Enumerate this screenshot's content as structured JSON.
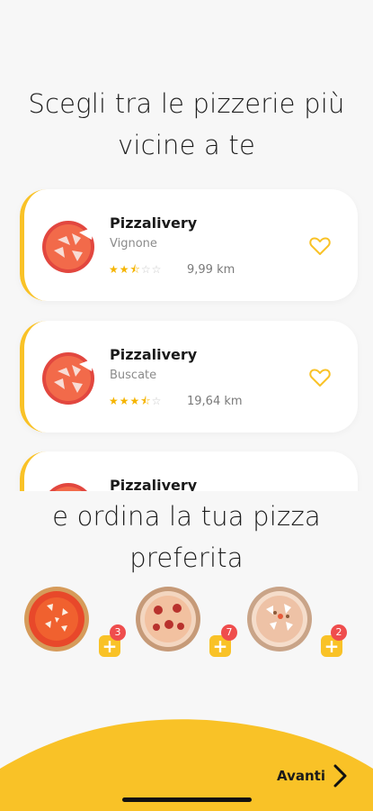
{
  "onboarding": {
    "title_top": "Scegli tra le pizzerie più vicine a te",
    "title_bottom": "e ordina la tua pizza preferita",
    "next_label": "Avanti"
  },
  "pizzerias": [
    {
      "name": "Pizzalivery",
      "city": "Vignone",
      "rating": 2.5,
      "distance": "9,99 km"
    },
    {
      "name": "Pizzalivery",
      "city": "Buscate",
      "rating": 3.5,
      "distance": "19,64 km"
    },
    {
      "name": "Pizzalivery"
    }
  ],
  "pizzas": [
    {
      "icon": "pizza-margherita-icon",
      "count": "3"
    },
    {
      "icon": "pizza-salami-icon",
      "count": "7"
    },
    {
      "icon": "pizza-mushroom-icon",
      "count": "2"
    }
  ],
  "colors": {
    "accent": "#f9c227",
    "badge": "#ef4d4d",
    "background": "#f7f7f7",
    "logo_red": "#e2473f"
  }
}
